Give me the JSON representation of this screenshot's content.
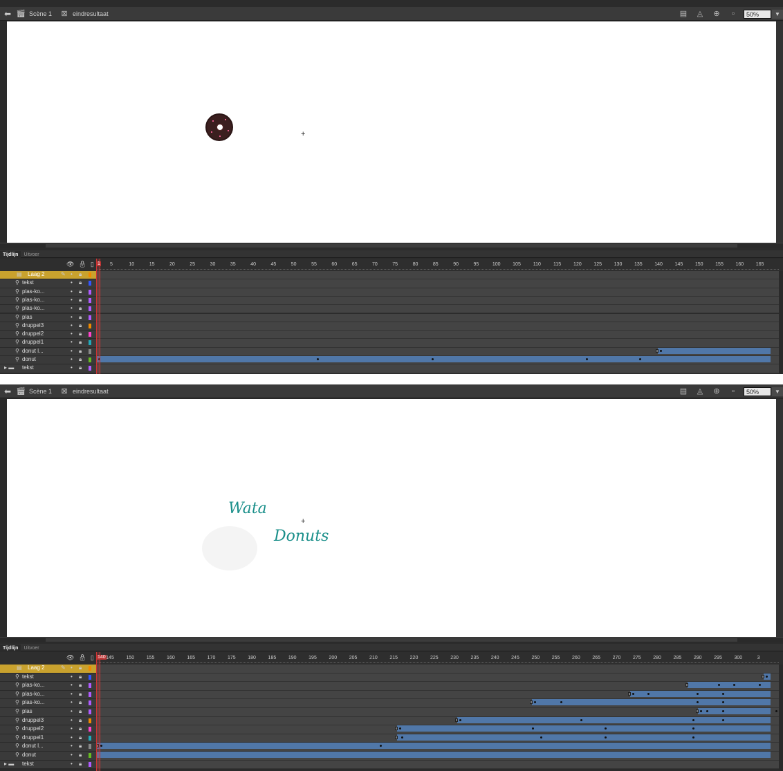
{
  "editbar": {
    "scene": "Scène 1",
    "symbol": "eindresultaat",
    "zoom": "50%"
  },
  "panel_tabs": [
    "Tijdlijn",
    "Uitvoer"
  ],
  "screen1": {
    "stage_text": [],
    "current_frame": "1",
    "ruler": [
      "5",
      "10",
      "15",
      "20",
      "25",
      "30",
      "35",
      "40",
      "45",
      "50",
      "55",
      "60",
      "65",
      "70",
      "75",
      "80",
      "85",
      "90",
      "95",
      "100",
      "105",
      "110",
      "115",
      "120",
      "125",
      "130",
      "135",
      "140",
      "145",
      "150",
      "155",
      "160",
      "165"
    ],
    "layers": [
      {
        "name": "Laag 2",
        "color": "#f08a00",
        "selected": true,
        "type": "layer"
      },
      {
        "name": "tekst",
        "color": "#3355ff",
        "type": "mask"
      },
      {
        "name": "plas-ko...",
        "color": "#b05cff",
        "type": "mask"
      },
      {
        "name": "plas-ko...",
        "color": "#b05cff",
        "type": "mask"
      },
      {
        "name": "plas-ko...",
        "color": "#b05cff",
        "type": "mask"
      },
      {
        "name": "plas",
        "color": "#b05cff",
        "type": "mask"
      },
      {
        "name": "druppel3",
        "color": "#f08a00",
        "type": "mask"
      },
      {
        "name": "druppel2",
        "color": "#ff44cc",
        "type": "mask"
      },
      {
        "name": "druppel1",
        "color": "#22aabb",
        "type": "mask"
      },
      {
        "name": "donut l...",
        "color": "#888888",
        "type": "mask"
      },
      {
        "name": "donut",
        "color": "#66bb22",
        "type": "mask"
      },
      {
        "name": "tekst",
        "color": "#b05cff",
        "type": "folder"
      }
    ]
  },
  "screen2": {
    "stage_text": [
      "Wata",
      "Donuts"
    ],
    "current_frame": "140",
    "ruler": [
      "145",
      "150",
      "155",
      "160",
      "165",
      "170",
      "175",
      "180",
      "185",
      "190",
      "195",
      "200",
      "205",
      "210",
      "215",
      "220",
      "225",
      "230",
      "235",
      "240",
      "245",
      "250",
      "255",
      "260",
      "265",
      "270",
      "275",
      "280",
      "285",
      "290",
      "295",
      "300",
      "3"
    ],
    "layers": [
      {
        "name": "Laag 2",
        "color": "#f08a00",
        "selected": true,
        "type": "layer"
      },
      {
        "name": "tekst",
        "color": "#3355ff",
        "type": "mask"
      },
      {
        "name": "plas-ko...",
        "color": "#b05cff",
        "type": "mask"
      },
      {
        "name": "plas-ko...",
        "color": "#b05cff",
        "type": "mask"
      },
      {
        "name": "plas-ko...",
        "color": "#b05cff",
        "type": "mask"
      },
      {
        "name": "plas",
        "color": "#b05cff",
        "type": "mask"
      },
      {
        "name": "druppel3",
        "color": "#f08a00",
        "type": "mask"
      },
      {
        "name": "druppel2",
        "color": "#ff44cc",
        "type": "mask"
      },
      {
        "name": "druppel1",
        "color": "#22aabb",
        "type": "mask"
      },
      {
        "name": "donut l...",
        "color": "#888888",
        "type": "mask"
      },
      {
        "name": "donut",
        "color": "#66bb22",
        "type": "mask"
      },
      {
        "name": "tekst",
        "color": "#b05cff",
        "type": "folder"
      }
    ]
  }
}
